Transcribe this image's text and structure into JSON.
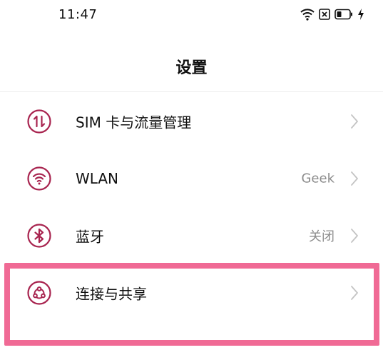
{
  "status_bar": {
    "time": "11:47",
    "icons": [
      "wifi-icon",
      "close-box-icon",
      "battery-icon",
      "charging-bolt-icon"
    ]
  },
  "header": {
    "title": "设置"
  },
  "settings": [
    {
      "icon": "sim-data-icon",
      "label": "SIM 卡与流量管理",
      "value": ""
    },
    {
      "icon": "wifi-icon",
      "label": "WLAN",
      "value": "Geek"
    },
    {
      "icon": "bluetooth-icon",
      "label": "蓝牙",
      "value": "关闭"
    },
    {
      "icon": "connection-share-icon",
      "label": "连接与共享",
      "value": ""
    }
  ],
  "colors": {
    "icon_accent": "#a8244f",
    "highlight": "#f06a95",
    "chevron": "#c4c4c4",
    "value_text": "#8c8c8c"
  }
}
